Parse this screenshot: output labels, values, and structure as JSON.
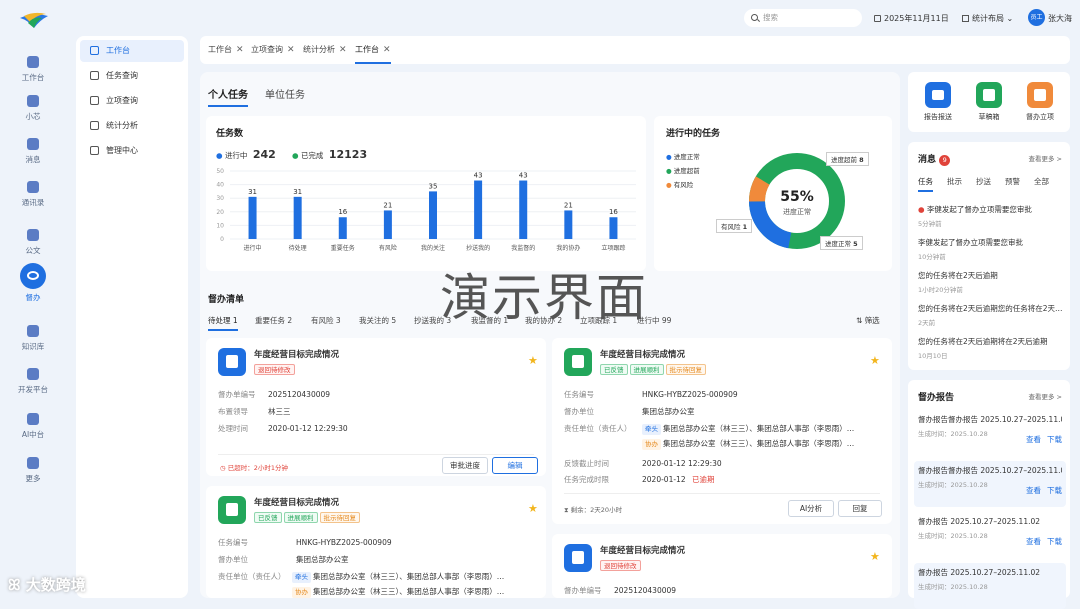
{
  "rail": [
    {
      "label": "工作台",
      "icon": "monitor-icon"
    },
    {
      "label": "小芯",
      "icon": "robot-icon"
    },
    {
      "label": "消息",
      "icon": "message-icon"
    },
    {
      "label": "通讯录",
      "icon": "contacts-icon"
    },
    {
      "label": "公文",
      "icon": "document-icon"
    },
    {
      "label": "督办",
      "icon": "eye-icon",
      "active": true
    },
    {
      "label": "知识库",
      "icon": "book-icon"
    },
    {
      "label": "开发平台",
      "icon": "dev-icon"
    },
    {
      "label": "AI中台",
      "icon": "ai-icon"
    },
    {
      "label": "更多",
      "icon": "grid-icon"
    }
  ],
  "submenu": [
    {
      "label": "工作台",
      "active": true
    },
    {
      "label": "任务查询"
    },
    {
      "label": "立项查询"
    },
    {
      "label": "统计分析"
    },
    {
      "label": "管理中心"
    }
  ],
  "topbar": {
    "search_placeholder": "搜索",
    "date": "2025年11月11日",
    "layout": "统计布局",
    "avatar": "员工",
    "user": "张大海"
  },
  "tabs": [
    "工作台",
    "立项查询",
    "统计分析",
    "工作台"
  ],
  "main_tabs": [
    "个人任务",
    "单位任务"
  ],
  "task_count": {
    "title": "任务数",
    "in_progress_label": "进行中",
    "in_progress": "242",
    "done_label": "已完成",
    "done": "12123"
  },
  "chart_data": {
    "type": "bar",
    "categories": [
      "进行中",
      "待处理",
      "重要任务",
      "有风险",
      "我的关注",
      "抄送我的",
      "我监督的",
      "我的协办",
      "立项跟踪"
    ],
    "values": [
      31,
      31,
      16,
      21,
      35,
      43,
      43,
      21,
      16
    ],
    "ylim": [
      0,
      50
    ],
    "yticks": [
      0,
      10,
      20,
      30,
      40,
      50
    ],
    "color": "#1f6fe0"
  },
  "ongoing": {
    "title": "进行中的任务",
    "legend": [
      "进度正常",
      "进度超前",
      "有风险"
    ],
    "percent": "55%",
    "center_label": "进度正常",
    "callouts": [
      {
        "label": "进度超前",
        "value": "8"
      },
      {
        "label": "有风险",
        "value": "1"
      },
      {
        "label": "进度正常",
        "value": "5"
      }
    ],
    "colors": [
      "#1f6fe0",
      "#22a65a",
      "#f08a3b"
    ]
  },
  "watermark": "演示界面",
  "list": {
    "title": "督办清单",
    "tabs": [
      "待处理 1",
      "重要任务 2",
      "有风险 3",
      "我关注的 5",
      "抄送我的 3",
      "我监督的 1",
      "我的协办 2",
      "立项跟踪 1",
      "进行中 99"
    ],
    "filter": "筛选"
  },
  "cards": [
    {
      "title": "年度经营目标完成情况",
      "tags": [
        {
          "t": "退回待修改",
          "c": "red"
        }
      ],
      "rows": [
        [
          "督办单编号",
          "2025120430009"
        ],
        [
          "布置领导",
          "林三三"
        ],
        [
          "处理时间",
          "2020-01-12 12:29:30"
        ]
      ],
      "footer": "已超时：2小时1分钟",
      "buttons": [
        "审批进度",
        "编辑"
      ]
    },
    {
      "title": "年度经营目标完成情况",
      "tags": [
        {
          "t": "已反馈",
          "c": "green"
        },
        {
          "t": "进展顺利",
          "c": "green"
        },
        {
          "t": "批示待回复",
          "c": "orange"
        }
      ],
      "rows": [
        [
          "任务编号",
          "HNKG-HYBZ2025-000909"
        ],
        [
          "督办单位",
          "集团总部办公室"
        ],
        [
          "责任单位（责任人）",
          ""
        ]
      ],
      "lead": {
        "tag": "牵头",
        "text": "集团总部办公室（林三三）、集团总部人事部（李思雨）…"
      },
      "assist": {
        "tag": "协办",
        "text": "集团总部办公室（林三三）、集团总部人事部（李思雨）…"
      },
      "rows2": [
        [
          "反馈截止时间",
          "2020-01-12 12:29:30"
        ],
        [
          "任务完成时限",
          "2020-01-12"
        ]
      ],
      "overdue": "已逾期",
      "footer": "剩余：2天20小时",
      "buttons": [
        "AI分析",
        "回复"
      ]
    },
    {
      "title": "年度经营目标完成情况",
      "tags": [
        {
          "t": "已反馈",
          "c": "green"
        },
        {
          "t": "进展顺利",
          "c": "green"
        },
        {
          "t": "批示待回复",
          "c": "orange"
        }
      ],
      "rows": [
        [
          "任务编号",
          "HNKG-HYBZ2025-000909"
        ],
        [
          "督办单位",
          "集团总部办公室"
        ],
        [
          "责任单位（责任人）",
          ""
        ]
      ],
      "lead": {
        "tag": "牵头",
        "text": "集团总部办公室（林三三）、集团总部人事部（李思雨）…"
      },
      "assist": {
        "tag": "协办",
        "text": "集团总部办公室（林三三）、集团总部人事部（李思雨）…"
      }
    },
    {
      "title": "年度经营目标完成情况",
      "tags": [
        {
          "t": "退回待修改",
          "c": "red"
        }
      ],
      "rows": [
        [
          "督办单编号",
          "2025120430009"
        ]
      ]
    }
  ],
  "quick": [
    {
      "label": "报告报送",
      "color": "#1f6fe0",
      "icon": "report-icon"
    },
    {
      "label": "草稿箱",
      "color": "#22a65a",
      "icon": "draft-icon"
    },
    {
      "label": "督办立项",
      "color": "#f08a3b",
      "icon": "project-icon"
    }
  ],
  "messages": {
    "title": "消息",
    "badge": "9",
    "more": "查看更多 >",
    "tabs": [
      "任务",
      "批示",
      "抄送",
      "预警",
      "全部"
    ],
    "items": [
      {
        "t": "李健发起了督办立项需要您审批",
        "s": "5分钟前",
        "dot": true
      },
      {
        "t": "李健发起了督办立项需要您审批",
        "s": "10分钟前"
      },
      {
        "t": "您的任务将在2天后逾期",
        "s": "1小时20分钟前"
      },
      {
        "t": "您的任务将在2天后逾期您的任务将在2天后…",
        "s": "2天前"
      },
      {
        "t": "您的任务将在2天后逾期将在2天后逾期",
        "s": "10月10日"
      }
    ]
  },
  "reports": {
    "title": "督办报告",
    "more": "查看更多 >",
    "items": [
      {
        "t": "督办报告督办报告 2025.10.27–2025.11.02",
        "s": "生成时间：2025.10.28",
        "a": [
          "查看",
          "下载"
        ]
      },
      {
        "t": "督办报告督办报告 2025.10.27–2025.11.02",
        "s": "生成时间：2025.10.28",
        "a": [
          "查看",
          "下载"
        ]
      },
      {
        "t": "督办报告 2025.10.27–2025.11.02",
        "s": "生成时间：2025.10.28",
        "a": [
          "查看",
          "下载"
        ]
      },
      {
        "t": "督办报告 2025.10.27–2025.11.02",
        "s": "生成时间：2025.10.28"
      }
    ]
  },
  "brand": "大数跨境"
}
